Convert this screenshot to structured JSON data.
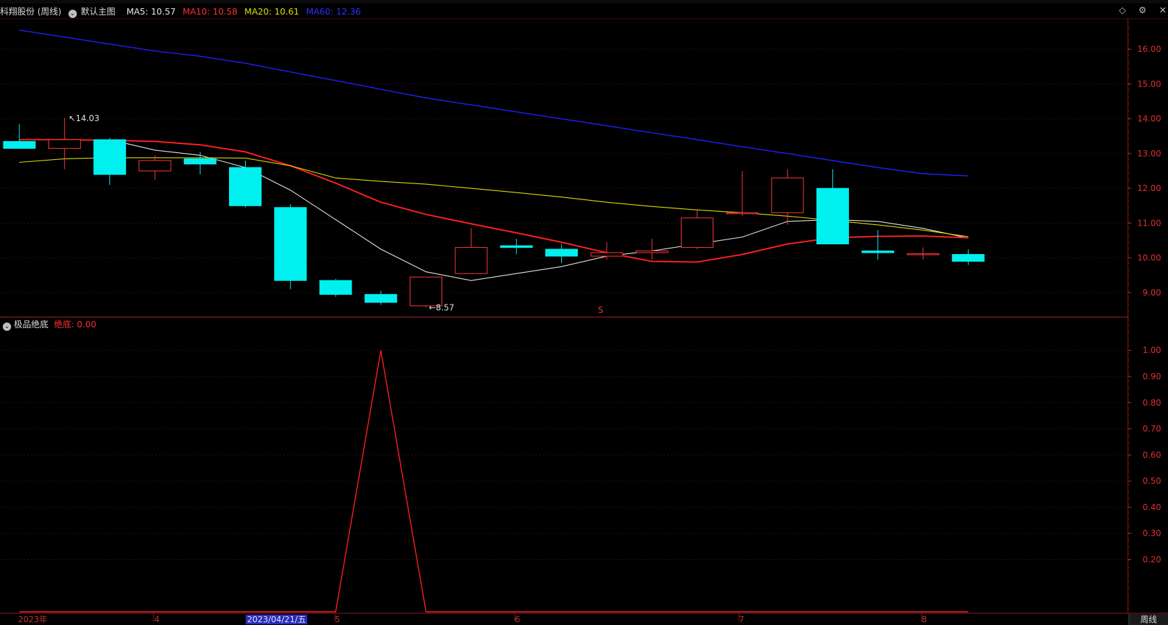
{
  "header": {
    "stock_label": "科翔股份 (周线)",
    "template_label": "默认主图",
    "ma5_label": "MA5: 10.57",
    "ma10_label": "MA10: 10.58",
    "ma20_label": "MA20: 10.61",
    "ma60_label": "MA60: 12.36",
    "toggle_icon": "chevron-down-icon"
  },
  "indicator": {
    "name": "极品绝底",
    "value_label": "绝底: 0.00"
  },
  "annotations": {
    "high": "14.03",
    "low": "8.57",
    "signal_mark": "S"
  },
  "x_axis": {
    "labels": [
      "2023年",
      "4",
      "2023/04/21/五",
      "5",
      "6",
      "7",
      "8"
    ]
  },
  "period": "周线",
  "colors": {
    "up": "#ff3b3b",
    "down": "#00f0f0",
    "ma5": "#e8e8e8",
    "ma10": "#ff2020",
    "ma20": "#e0e000",
    "ma60": "#2020ff",
    "axis": "#c03030",
    "indicator_line": "#ff2020"
  },
  "chart_data": [
    {
      "type": "candlestick",
      "title": "科翔股份 (周线)",
      "ylim": [
        8.3,
        16.9
      ],
      "y_ticks": [
        9.0,
        10.0,
        11.0,
        12.0,
        13.0,
        14.0,
        15.0,
        16.0
      ],
      "candles": [
        {
          "open": 13.35,
          "close": 13.15,
          "high": 13.85,
          "low": 13.15
        },
        {
          "open": 13.15,
          "close": 13.4,
          "high": 14.03,
          "low": 12.55
        },
        {
          "open": 13.4,
          "close": 12.4,
          "high": 13.45,
          "low": 12.1
        },
        {
          "open": 12.5,
          "close": 12.8,
          "high": 12.95,
          "low": 12.25
        },
        {
          "open": 12.85,
          "close": 12.7,
          "high": 13.05,
          "low": 12.4
        },
        {
          "open": 12.6,
          "close": 11.5,
          "high": 12.8,
          "low": 11.45
        },
        {
          "open": 11.45,
          "close": 9.35,
          "high": 11.55,
          "low": 9.1
        },
        {
          "open": 9.35,
          "close": 8.95,
          "high": 9.4,
          "low": 8.88
        },
        {
          "open": 8.95,
          "close": 8.72,
          "high": 9.05,
          "low": 8.65
        },
        {
          "open": 8.62,
          "close": 9.45,
          "high": 9.45,
          "low": 8.57
        },
        {
          "open": 9.55,
          "close": 10.3,
          "high": 10.85,
          "low": 9.55
        },
        {
          "open": 10.35,
          "close": 10.3,
          "high": 10.55,
          "low": 10.1
        },
        {
          "open": 10.25,
          "close": 10.05,
          "high": 10.4,
          "low": 9.85
        },
        {
          "open": 10.05,
          "close": 10.15,
          "high": 10.45,
          "low": 9.95
        },
        {
          "open": 10.15,
          "close": 10.2,
          "high": 10.55,
          "low": 9.95
        },
        {
          "open": 10.3,
          "close": 11.15,
          "high": 11.4,
          "low": 10.25
        },
        {
          "open": 11.3,
          "close": 11.3,
          "high": 12.5,
          "low": 11.2
        },
        {
          "open": 11.3,
          "close": 12.3,
          "high": 12.55,
          "low": 10.95
        },
        {
          "open": 12.0,
          "close": 10.4,
          "high": 12.55,
          "low": 10.4
        },
        {
          "open": 10.2,
          "close": 10.15,
          "high": 10.8,
          "low": 9.95
        },
        {
          "open": 10.12,
          "close": 10.12,
          "high": 10.3,
          "low": 9.95
        },
        {
          "open": 10.1,
          "close": 9.9,
          "high": 10.25,
          "low": 9.8
        }
      ],
      "series": [
        {
          "name": "MA5",
          "values": [
            null,
            null,
            13.4,
            13.1,
            12.95,
            12.6,
            11.95,
            11.1,
            10.25,
            9.6,
            9.35,
            9.55,
            9.75,
            10.05,
            10.2,
            10.4,
            10.6,
            11.05,
            11.1,
            11.05,
            10.85,
            10.57
          ]
        },
        {
          "name": "MA10",
          "values": [
            13.4,
            13.4,
            13.38,
            13.35,
            13.25,
            13.05,
            12.65,
            12.15,
            11.6,
            11.25,
            10.98,
            10.72,
            10.45,
            10.15,
            9.9,
            9.88,
            10.1,
            10.4,
            10.58,
            10.62,
            10.63,
            10.58
          ]
        },
        {
          "name": "MA20",
          "values": [
            12.75,
            12.85,
            12.88,
            12.88,
            12.88,
            12.87,
            12.65,
            12.3,
            12.2,
            12.12,
            12.0,
            11.88,
            11.75,
            11.6,
            11.48,
            11.38,
            11.3,
            11.2,
            11.08,
            10.95,
            10.8,
            10.61
          ]
        },
        {
          "name": "MA60",
          "values": [
            16.55,
            16.35,
            16.15,
            15.95,
            15.8,
            15.6,
            15.35,
            15.1,
            14.85,
            14.6,
            14.4,
            14.2,
            14.0,
            13.8,
            13.6,
            13.4,
            13.2,
            13.0,
            12.8,
            12.6,
            12.42,
            12.36
          ]
        }
      ]
    },
    {
      "type": "line",
      "title": "极品绝底",
      "ylim": [
        0.0,
        1.08
      ],
      "y_ticks": [
        0.2,
        0.3,
        0.4,
        0.5,
        0.6,
        0.7,
        0.8,
        0.9,
        1.0
      ],
      "series": [
        {
          "name": "绝底",
          "values": [
            0,
            0,
            0,
            0,
            0,
            0,
            0,
            0,
            1.0,
            0,
            0,
            0,
            0,
            0,
            0,
            0,
            0,
            0,
            0,
            0,
            0,
            0
          ]
        }
      ]
    }
  ]
}
